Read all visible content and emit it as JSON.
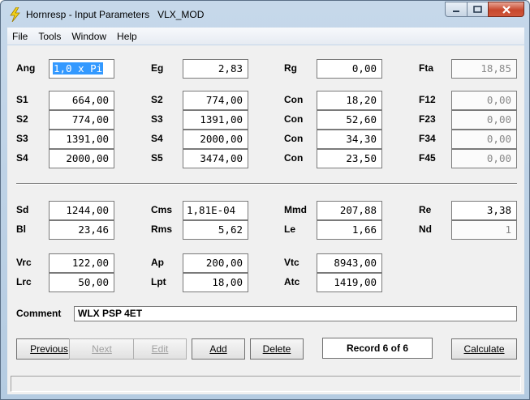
{
  "window": {
    "title": "Hornresp - Input Parameters   VLX_MOD"
  },
  "menu": [
    "File",
    "Tools",
    "Window",
    "Help"
  ],
  "fields": {
    "ang": {
      "label": "Ang",
      "value": "1,0 x Pi"
    },
    "eg": {
      "label": "Eg",
      "value": "2,83"
    },
    "rg": {
      "label": "Rg",
      "value": "0,00"
    },
    "fta": {
      "label": "Fta",
      "value": "18,85"
    },
    "s1": {
      "label": "S1",
      "value": "664,00"
    },
    "s2a": {
      "label": "S2",
      "value": "774,00"
    },
    "s3a": {
      "label": "S3",
      "value": "1391,00"
    },
    "s4a": {
      "label": "S4",
      "value": "2000,00"
    },
    "s2b": {
      "label": "S2",
      "value": "774,00"
    },
    "s3b": {
      "label": "S3",
      "value": "1391,00"
    },
    "s4b": {
      "label": "S4",
      "value": "2000,00"
    },
    "s5": {
      "label": "S5",
      "value": "3474,00"
    },
    "con1": {
      "label": "Con",
      "value": "18,20"
    },
    "con2": {
      "label": "Con",
      "value": "52,60"
    },
    "con3": {
      "label": "Con",
      "value": "34,30"
    },
    "con4": {
      "label": "Con",
      "value": "23,50"
    },
    "f12": {
      "label": "F12",
      "value": "0,00"
    },
    "f23": {
      "label": "F23",
      "value": "0,00"
    },
    "f34": {
      "label": "F34",
      "value": "0,00"
    },
    "f45": {
      "label": "F45",
      "value": "0,00"
    },
    "sd": {
      "label": "Sd",
      "value": "1244,00"
    },
    "bl": {
      "label": "Bl",
      "value": "23,46"
    },
    "cms": {
      "label": "Cms",
      "value": "1,81E-04"
    },
    "rms": {
      "label": "Rms",
      "value": "5,62"
    },
    "mmd": {
      "label": "Mmd",
      "value": "207,88"
    },
    "le": {
      "label": "Le",
      "value": "1,66"
    },
    "re": {
      "label": "Re",
      "value": "3,38"
    },
    "nd": {
      "label": "Nd",
      "value": "1"
    },
    "vrc": {
      "label": "Vrc",
      "value": "122,00"
    },
    "lrc": {
      "label": "Lrc",
      "value": "50,00"
    },
    "ap": {
      "label": "Ap",
      "value": "200,00"
    },
    "lpt": {
      "label": "Lpt",
      "value": "18,00"
    },
    "vtc": {
      "label": "Vtc",
      "value": "8943,00"
    },
    "atc": {
      "label": "Atc",
      "value": "1419,00"
    }
  },
  "comment": {
    "label": "Comment",
    "value": "WLX PSP 4ET"
  },
  "buttons": {
    "previous": {
      "label": "Previous",
      "enabled": true
    },
    "next": {
      "label": "Next",
      "enabled": false
    },
    "edit": {
      "label": "Edit",
      "enabled": false
    },
    "add": {
      "label": "Add",
      "enabled": true
    },
    "delete": {
      "label": "Delete",
      "enabled": true
    },
    "calculate": {
      "label": "Calculate",
      "enabled": true
    }
  },
  "record": "Record 6 of 6",
  "icons": {
    "app": "lightning-bolt-icon",
    "minimize": "minimize-icon",
    "maximize": "maximize-icon",
    "close": "close-icon"
  },
  "colors": {
    "close_button": "#c7482d",
    "selection": "#3399ff",
    "dialog_bg": "#f0f0f0"
  }
}
